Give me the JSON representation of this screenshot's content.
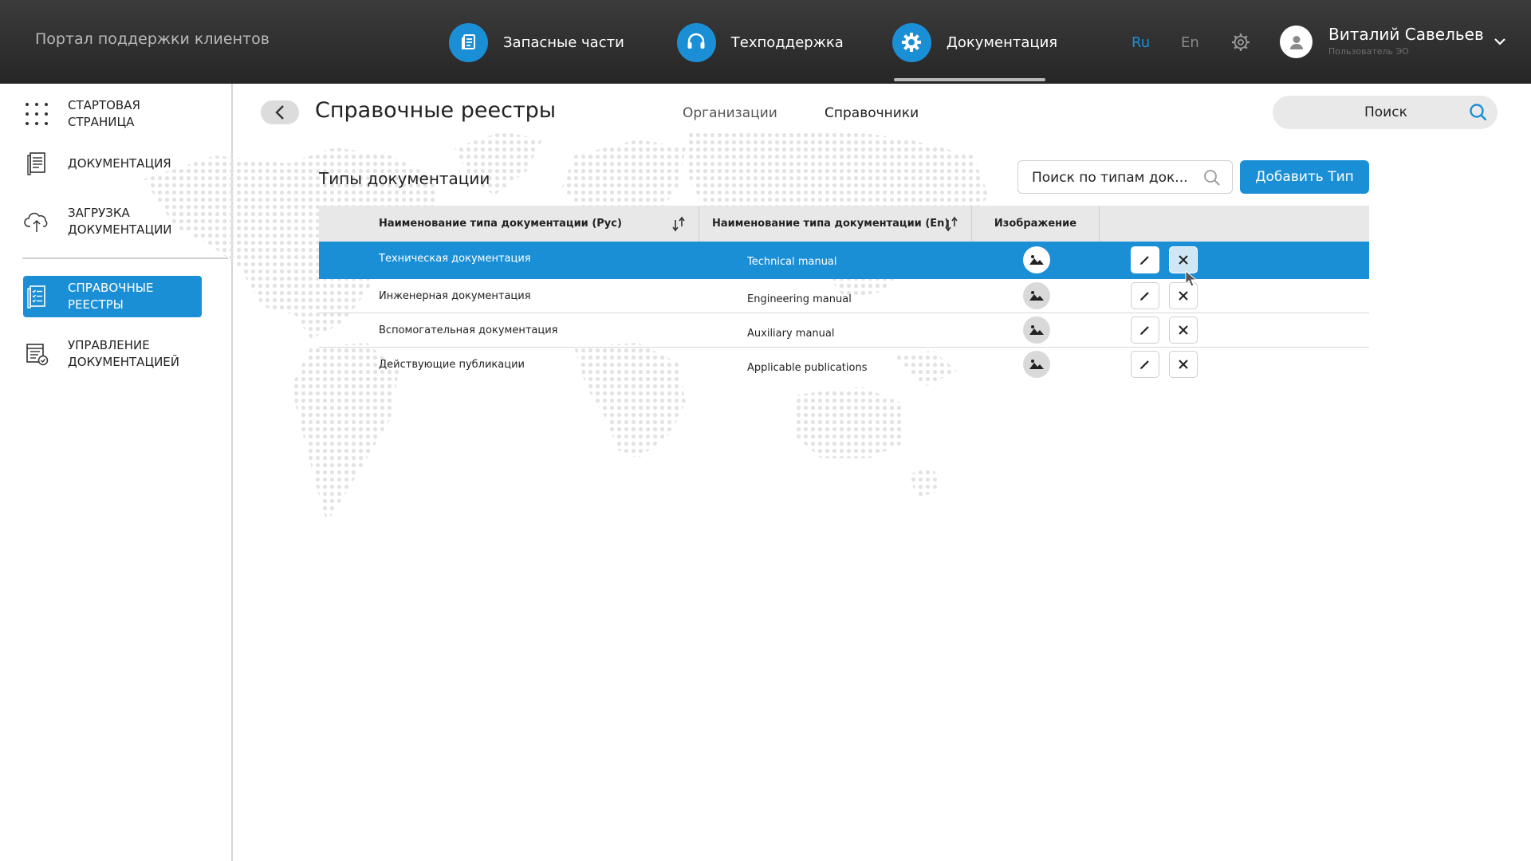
{
  "portal_title": "Портал поддержки клиентов",
  "top_nav": [
    {
      "label": "Запасные части",
      "icon": "document-list-icon",
      "active": false
    },
    {
      "label": "Техподдержка",
      "icon": "headset-icon",
      "active": false
    },
    {
      "label": "Документация",
      "icon": "gear-icon",
      "active": true
    }
  ],
  "languages": {
    "ru": "Ru",
    "en": "En",
    "selected": "Ru"
  },
  "user": {
    "name": "Виталий Савельев",
    "role": "Пользователь ЭО"
  },
  "sidebar": {
    "items": [
      {
        "label": "Стартовая страница",
        "icon": "grid-dots-icon",
        "active": false
      },
      {
        "label": "Документация",
        "icon": "document-icon",
        "active": false
      },
      {
        "label": "Загрузка документации",
        "icon": "cloud-upload-icon",
        "active": false
      },
      {
        "label": "Справочные реестры",
        "icon": "checklist-icon",
        "active": true
      },
      {
        "label": "Управление документацией",
        "icon": "document-manage-icon",
        "active": false
      }
    ]
  },
  "page": {
    "title": "Справочные реестры",
    "tabs": [
      "Организации",
      "Справочники"
    ],
    "active_tab": "Справочники",
    "global_search_placeholder": "Поиск"
  },
  "section": {
    "title": "Типы документации",
    "search_placeholder": "Поиск по типам док...",
    "add_button": "Добавить Тип"
  },
  "table": {
    "columns": [
      "Наименование типа документации (Рус)",
      "Наименование типа документации (En)",
      "Изображение",
      ""
    ],
    "rows": [
      {
        "ru": "Техническая документация",
        "en": "Technical manual",
        "selected": true
      },
      {
        "ru": "Инженерная документация",
        "en": "Engineering manual",
        "selected": false
      },
      {
        "ru": "Вспомогательная документация",
        "en": "Auxiliary manual",
        "selected": false
      },
      {
        "ru": "Действующие публикации",
        "en": "Applicable publications",
        "selected": false
      }
    ]
  },
  "colors": {
    "accent": "#1b8fd6",
    "topbar": "#2f2f2f",
    "map_dots": "#e3e3e3"
  }
}
